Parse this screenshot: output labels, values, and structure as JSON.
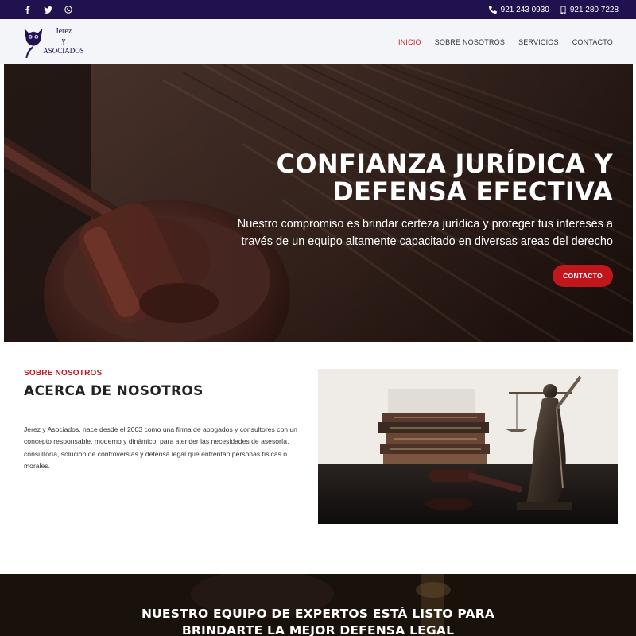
{
  "topbar": {
    "social": [
      {
        "icon": "facebook-icon",
        "glyph": "f"
      },
      {
        "icon": "twitter-icon",
        "glyph": "🐦"
      },
      {
        "icon": "whatsapp-icon",
        "glyph": "✆"
      }
    ],
    "phone1": "921 243 0930",
    "phone2": "921 280 7228",
    "bg_color": "#22114f"
  },
  "header": {
    "logo_text_line1": "Jerez",
    "logo_text_line2": "y",
    "logo_text_line3": "Asociados",
    "nav": [
      "INICIO",
      "SOBRE NOSOTROS",
      "SERVICIOS",
      "CONTACTO"
    ],
    "active_color": "#c0232a"
  },
  "hero": {
    "title_line1": "CONFIANZA JURÍDICA Y",
    "title_line2": "DEFENSA EFECTIVA",
    "subtitle_line1": "Nuestro compromiso es brindar certeza jurídica y proteger tus intereses a",
    "subtitle_line2": "través de un equipo altamente capacitado en diversas areas del derecho",
    "cta_label": "CONTACTO",
    "cta_color": "#c0171d"
  },
  "about": {
    "kicker": "SOBRE NOSOTROS",
    "title": "ACERCA DE NOSOTROS",
    "body": "Jerez y Asociados, nace desde el 2003 como una firma de abogados y consultores con un concepto responsable, moderno y dinámico, para atender las necesidades de asesoría, consultoría, solución de controversias y defensa legal que enfrentan personas físicas o morales."
  },
  "banner": {
    "title_line1": "NUESTRO EQUIPO DE EXPERTOS ESTÁ LISTO PARA",
    "title_line2": "BRINDARTE LA MEJOR DEFENSA LEGAL"
  }
}
